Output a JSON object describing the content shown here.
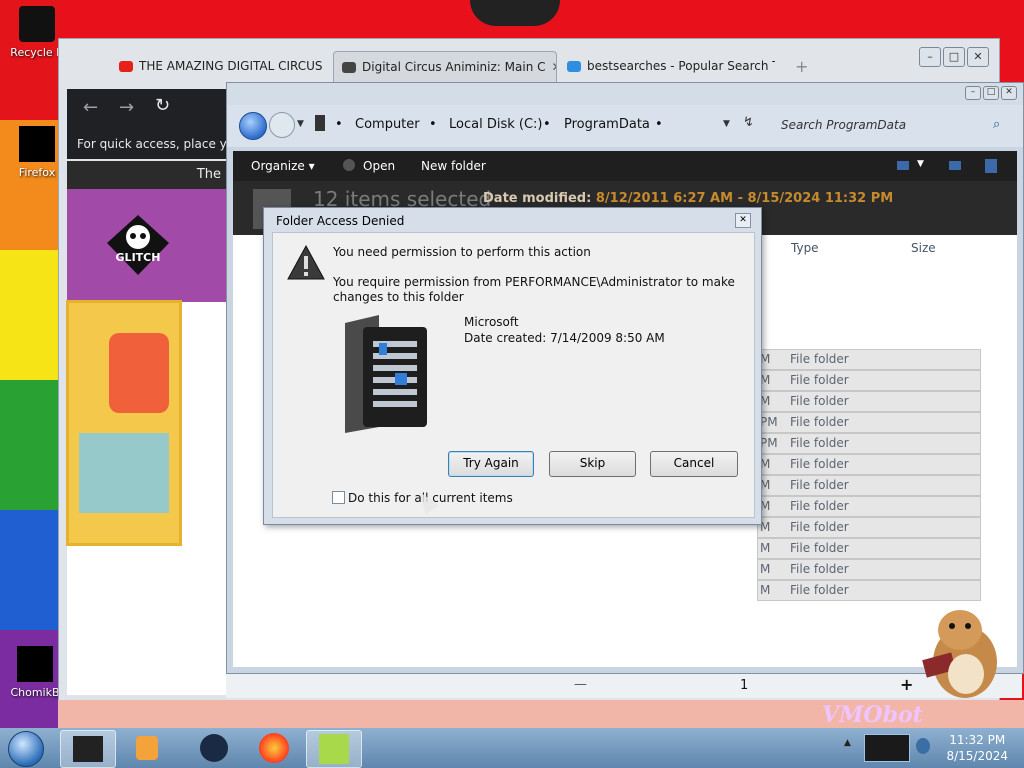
{
  "desktop": {
    "icons": [
      {
        "label": "Recycle B"
      },
      {
        "label": "Firefox"
      },
      {
        "label": "ChomikB"
      }
    ],
    "watermark": "VMObot"
  },
  "browser": {
    "tabs": [
      {
        "label": "THE AMAZING DIGITAL CIRCUS",
        "close": "✕"
      },
      {
        "label": "Digital Circus Animiniz: Main C",
        "close": "✕"
      },
      {
        "label": "bestsearches - Popular Search T",
        "close": "✕"
      }
    ],
    "new_tab": "+",
    "quick_access": "For quick access, place your",
    "bar_text": "The",
    "logo_text": "GLITCH"
  },
  "explorer": {
    "breadcrumbs": [
      "Computer",
      "Local Disk (C:)",
      "ProgramData"
    ],
    "search_placeholder": "Search ProgramData",
    "toolbar": {
      "organize": "Organize",
      "open": "Open",
      "new_folder": "New folder"
    },
    "selection": "12 items selected",
    "date_modified_label": "Date modified:",
    "date_modified_value": "8/12/2011 6:27 AM - 8/15/2024 11:32 PM",
    "columns": {
      "type": "Type",
      "size": "Size"
    },
    "rows": [
      {
        "m": "M",
        "type": "File folder"
      },
      {
        "m": "M",
        "type": "File folder"
      },
      {
        "m": "M",
        "type": "File folder"
      },
      {
        "m": "PM",
        "type": "File folder"
      },
      {
        "m": "PM",
        "type": "File folder"
      },
      {
        "m": "M",
        "type": "File folder"
      },
      {
        "m": "M",
        "type": "File folder"
      },
      {
        "m": "M",
        "type": "File folder"
      },
      {
        "m": "M",
        "type": "File folder"
      },
      {
        "m": "M",
        "type": "File folder"
      },
      {
        "m": "M",
        "type": "File folder"
      },
      {
        "m": "M",
        "type": "File folder"
      }
    ],
    "statusbar": {
      "minus": "—",
      "page": "1",
      "plus": "+"
    }
  },
  "dialog": {
    "title": "Folder Access Denied",
    "heading": "You need permission to perform this action",
    "message": "You require permission from PERFORMANCE\\Administrator to make changes to this folder",
    "item_name": "Microsoft",
    "item_date": "Date created: 7/14/2009 8:50 AM",
    "buttons": {
      "try_again": "Try Again",
      "skip": "Skip",
      "cancel": "Cancel"
    },
    "checkbox_label": "Do this for all current items"
  },
  "taskbar": {
    "time": "11:32 PM",
    "date": "8/15/2024"
  }
}
